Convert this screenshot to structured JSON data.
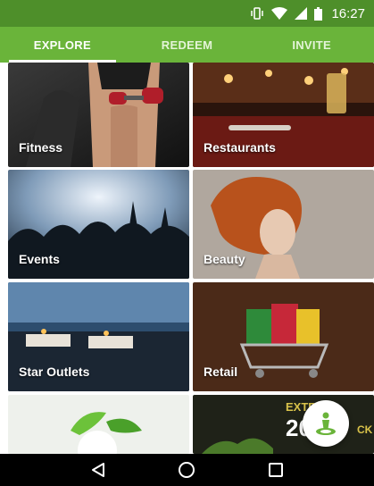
{
  "status_bar": {
    "time": "16:27",
    "icons": [
      "vibrate-icon",
      "wifi-icon",
      "signal-icon",
      "battery-icon"
    ]
  },
  "tabs": [
    {
      "label": "EXPLORE",
      "active": true
    },
    {
      "label": "REDEEM",
      "active": false
    },
    {
      "label": "INVITE",
      "active": false
    }
  ],
  "categories": [
    {
      "label": "Fitness"
    },
    {
      "label": "Restaurants"
    },
    {
      "label": "Events"
    },
    {
      "label": "Beauty"
    },
    {
      "label": "Star Outlets"
    },
    {
      "label": "Retail"
    },
    {
      "label": ""
    },
    {
      "label": "",
      "banner_text": [
        "EXTR",
        "20",
        "CK"
      ]
    }
  ],
  "fab": {
    "icon": "location-pin-icon"
  },
  "nav_bar": {
    "icons": [
      "back-icon",
      "home-icon",
      "recents-icon"
    ]
  },
  "colors": {
    "primary": "#6ab43a",
    "primary_dark": "#4e8f2a",
    "fab_icon": "#6ab43a"
  }
}
